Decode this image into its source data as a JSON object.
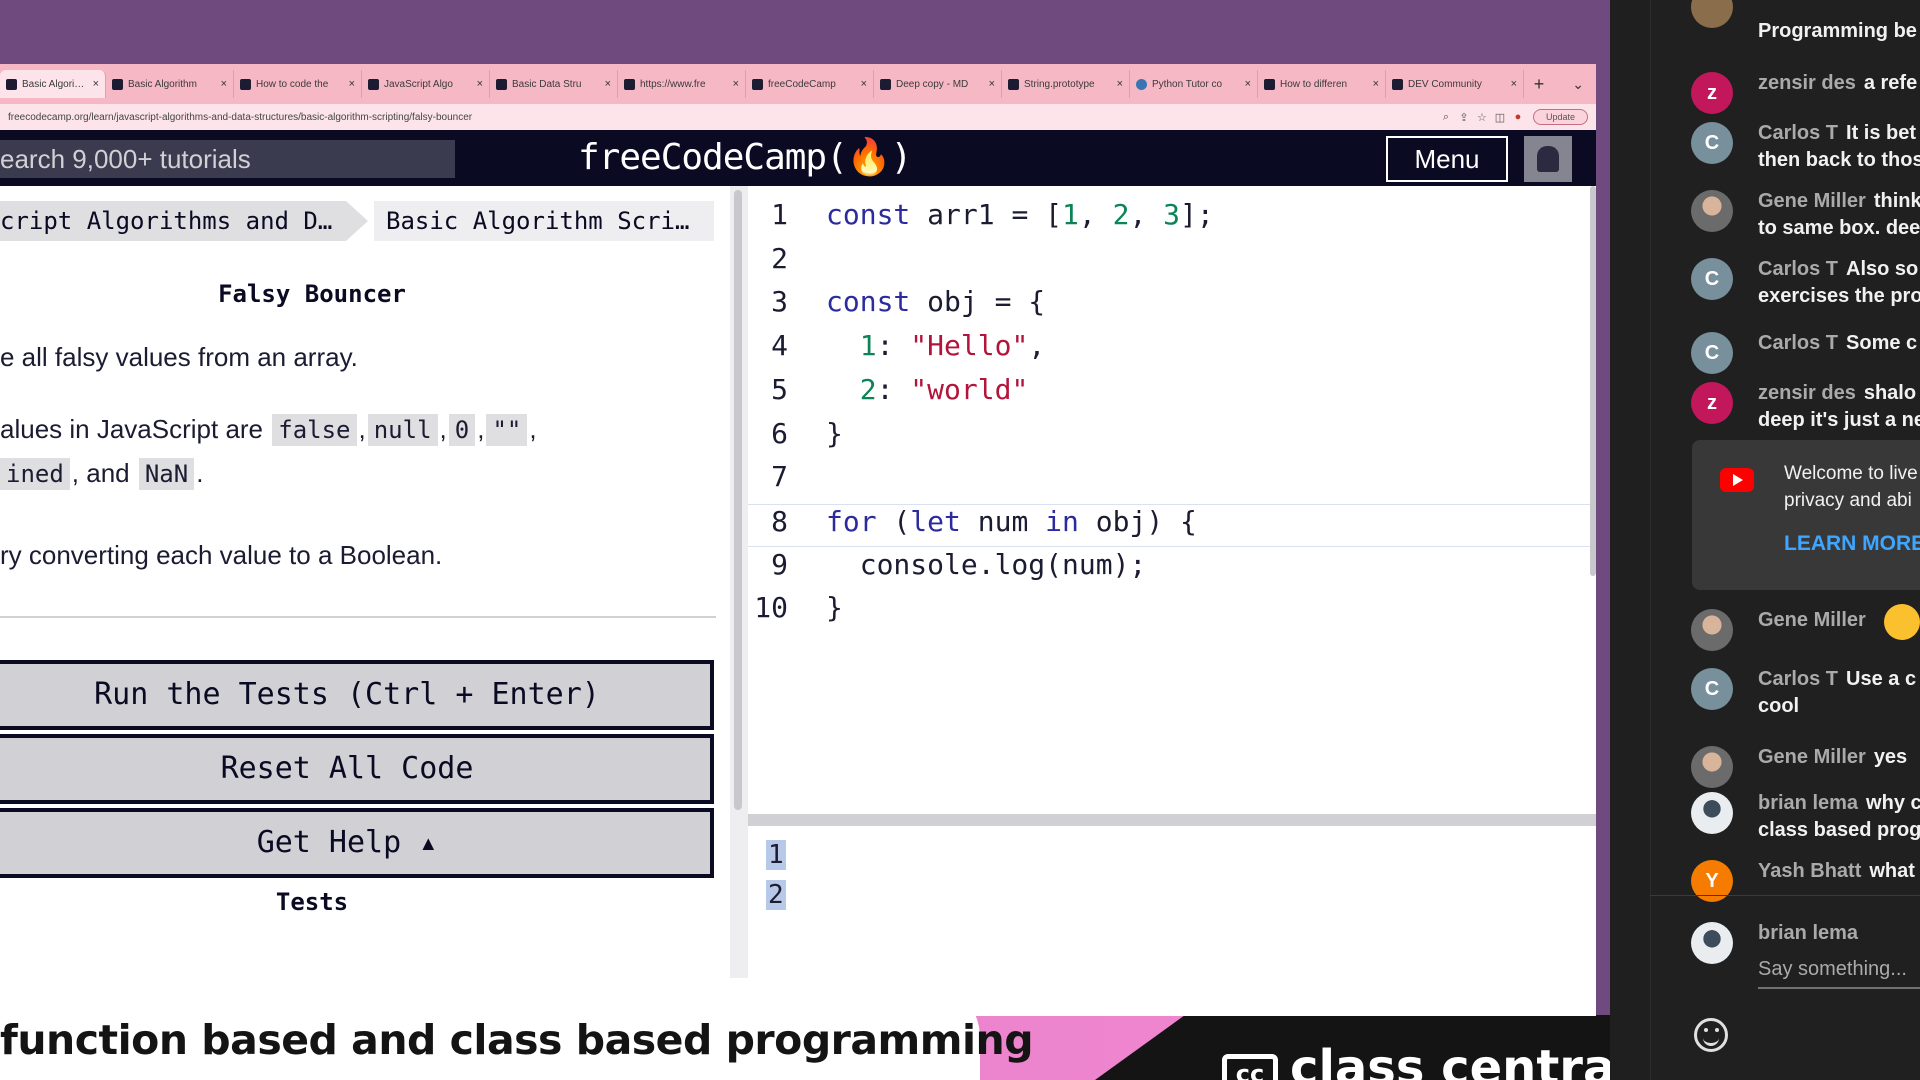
{
  "browser": {
    "tabs": [
      {
        "title": "Basic Algorithm",
        "active": true,
        "favicon": "fcc-icon"
      },
      {
        "title": "Basic Algorithm",
        "active": false,
        "favicon": "fcc-icon"
      },
      {
        "title": "How to code the",
        "active": false,
        "favicon": "fcc-icon"
      },
      {
        "title": "JavaScript Algo",
        "active": false,
        "favicon": "fcc-icon"
      },
      {
        "title": "Basic Data Stru",
        "active": false,
        "favicon": "fcc-icon"
      },
      {
        "title": "https://www.fre",
        "active": false,
        "favicon": "fcc-icon"
      },
      {
        "title": "freeCodeCamp",
        "active": false,
        "favicon": "fcc-icon"
      },
      {
        "title": "Deep copy - MD",
        "active": false,
        "favicon": "fcc-icon"
      },
      {
        "title": "String.prototype",
        "active": false,
        "favicon": "fcc-icon"
      },
      {
        "title": "Python Tutor co",
        "active": false,
        "favicon": "python-icon"
      },
      {
        "title": "How to differen",
        "active": false,
        "favicon": "fcc-icon"
      },
      {
        "title": "DEV Community",
        "active": false,
        "favicon": "fcc-icon"
      }
    ],
    "new_tab": "+",
    "url": "freecodecamp.org/learn/javascript-algorithms-and-data-structures/basic-algorithm-scripting/falsy-bouncer",
    "update_label": "Update"
  },
  "fcc_nav": {
    "search_placeholder": "earch 9,000+ tutorials",
    "logo": "freeCodeCamp(🔥)",
    "menu_label": "Menu"
  },
  "instructions": {
    "breadcrumb_1": "cript Algorithms and D…",
    "breadcrumb_2": "Basic Algorithm Scri…",
    "title": "Falsy Bouncer",
    "para1": "e all falsy values from an array.",
    "para2_prefix": "alues in JavaScript are ",
    "para2_chips": [
      "false",
      "null",
      "0",
      "\"\""
    ],
    "para3_chip1": "ined",
    "para3_mid": ", and ",
    "para3_chip2": "NaN",
    "para3_suffix": ".",
    "para4": "ry converting each value to a Boolean.",
    "run_tests_label": "Run the Tests (Ctrl + Enter)",
    "reset_label": "Reset All Code",
    "help_label": "Get Help ▴",
    "tests_heading": "Tests"
  },
  "editor": {
    "lines": [
      {
        "no": "1",
        "code": "const arr1 = [1, 2, 3];"
      },
      {
        "no": "2",
        "code": ""
      },
      {
        "no": "3",
        "code": "const obj = {"
      },
      {
        "no": "4",
        "code": "  1: \"Hello\","
      },
      {
        "no": "5",
        "code": "  2: \"world\""
      },
      {
        "no": "6",
        "code": "}"
      },
      {
        "no": "7",
        "code": ""
      },
      {
        "no": "8",
        "code": "for (let num in obj) {"
      },
      {
        "no": "9",
        "code": "  console.log(num);"
      },
      {
        "no": "10",
        "code": "}"
      }
    ],
    "current_line": 8
  },
  "console": {
    "output": [
      "1",
      "2"
    ]
  },
  "caption": {
    "text": "function based and class based programming"
  },
  "branding": {
    "logo_box": "cc",
    "logo_word": "class central"
  },
  "chat": {
    "messages": [
      {
        "author": "",
        "lines": [
          "Programming be"
        ],
        "avatar": "top"
      },
      {
        "author": "zensir des",
        "lines": [
          "a refe"
        ],
        "avatar_letter": "z"
      },
      {
        "author": "Carlos T",
        "lines": [
          "It is bet",
          "then back to thos"
        ],
        "avatar_letter": "C"
      },
      {
        "author": "Gene Miller",
        "lines": [
          "think",
          "to same box. dee"
        ],
        "avatar_letter": ""
      },
      {
        "author": "Carlos T",
        "lines": [
          "Also so",
          "exercises the pro"
        ],
        "avatar_letter": "C"
      },
      {
        "author": "Carlos T",
        "lines": [
          "Some c"
        ],
        "avatar_letter": "C"
      },
      {
        "author": "zensir des",
        "lines": [
          "shalo",
          "deep it's just a ne"
        ],
        "avatar_letter": "z"
      },
      {
        "author": "Gene Miller",
        "lines": [
          ""
        ],
        "avatar_letter": ""
      },
      {
        "author": "Carlos T",
        "lines": [
          "Use a c",
          "cool"
        ],
        "avatar_letter": "C"
      },
      {
        "author": "Gene Miller",
        "lines": [
          "yes"
        ],
        "avatar_letter": ""
      },
      {
        "author": "brian lema",
        "lines": [
          "why c",
          "class based prog"
        ],
        "avatar_letter": ""
      },
      {
        "author": "Yash Bhatt",
        "lines": [
          "what"
        ],
        "avatar_letter": "Y"
      }
    ],
    "welcome_text_1": "Welcome to live",
    "welcome_text_2": "privacy and abi",
    "learn_more": "LEARN MORE",
    "input_author": "brian lema",
    "input_placeholder": "Say something..."
  },
  "colors": {
    "stream_bg": "#6e4a7e",
    "tabbar": "#f7b8c6",
    "fcc_nav": "#0a0a23",
    "keyword": "#2b2b9f",
    "number": "#0b8457",
    "string": "#b3143b",
    "chat_bg": "#202020",
    "link_blue": "#3ea6ff"
  }
}
